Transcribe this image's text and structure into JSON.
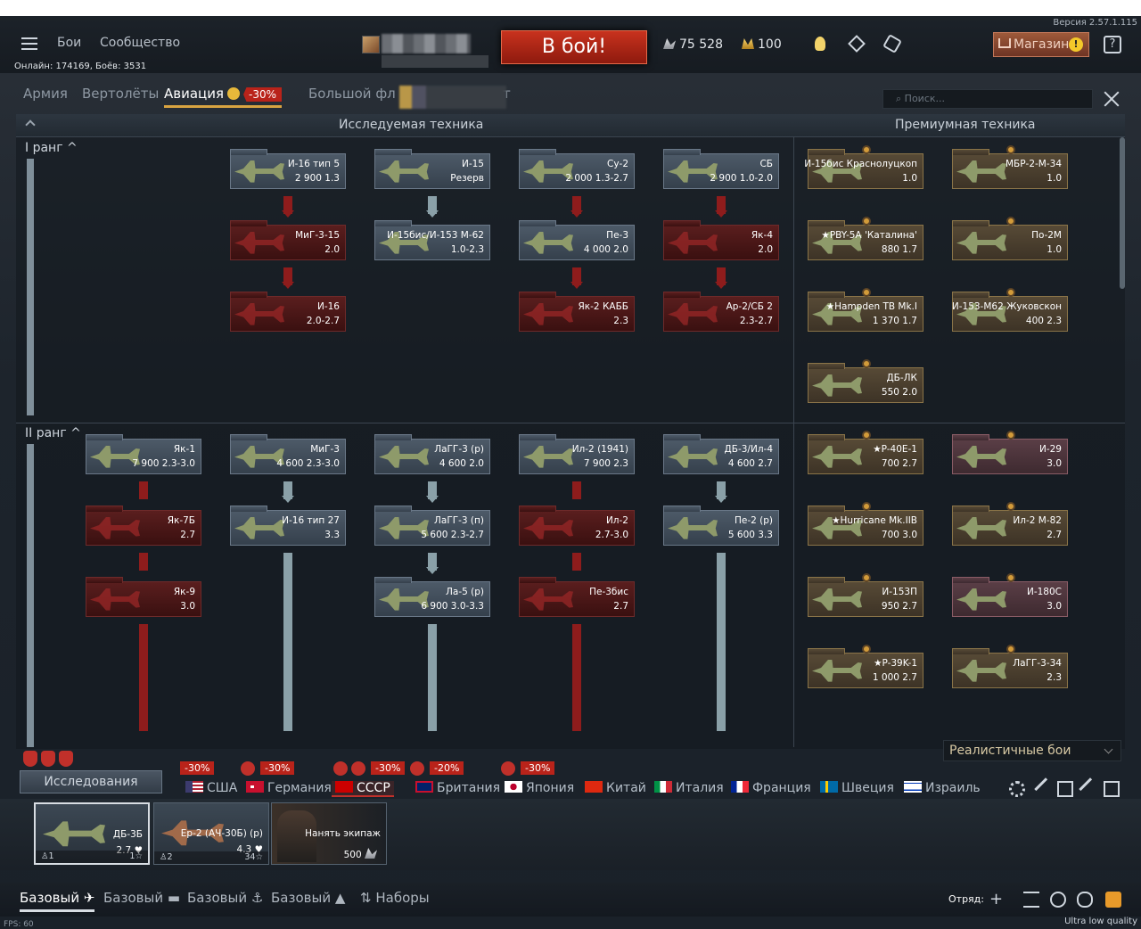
{
  "header": {
    "version": "Версия 2.57.1.115",
    "nav": [
      "Бои",
      "Сообщество"
    ],
    "online": "Онлайн: 174169, Боёв: 3531",
    "battle_button": "В бой!",
    "silver": "75 528",
    "gold": "100",
    "shop": "Магазин",
    "shop_alert": "!",
    "help": "?"
  },
  "tabs": {
    "items": [
      "Армия",
      "Вертолёты",
      "Авиация",
      "Большой фл"
    ],
    "active_discount": "-30%",
    "fleet_suffix": "т"
  },
  "search": {
    "placeholder": "Поиск..."
  },
  "tree": {
    "researched_title": "Исследуемая техника",
    "premium_title": "Премиумная техника",
    "rank1": "I ранг",
    "rank2": "II ранг",
    "cards": [
      {
        "id": "c1",
        "name": "И-16 тип 5",
        "stats": "2 900 1.3",
        "state": "normal"
      },
      {
        "id": "c2",
        "name": "И-15",
        "stats": "Резерв",
        "state": "normal"
      },
      {
        "id": "c3",
        "name": "Су-2",
        "stats": "2 000 1.3-2.7",
        "state": "normal"
      },
      {
        "id": "c4",
        "name": "СБ",
        "stats": "2 900 1.0-2.0",
        "state": "normal"
      },
      {
        "id": "c5",
        "name": "МиГ-3-15",
        "stats": "2.0",
        "state": "locked"
      },
      {
        "id": "c6",
        "name": "И-15бис/И-153 М-62",
        "stats": "1.0-2.3",
        "state": "normal"
      },
      {
        "id": "c7",
        "name": "Пе-3",
        "stats": "4 000 2.0",
        "state": "normal"
      },
      {
        "id": "c8",
        "name": "Як-4",
        "stats": "2.0",
        "state": "locked"
      },
      {
        "id": "c9",
        "name": "И-16",
        "stats": "2.0-2.7",
        "state": "locked"
      },
      {
        "id": "c10",
        "name": "Як-2 КАББ",
        "stats": "2.3",
        "state": "locked"
      },
      {
        "id": "c11",
        "name": "Ар-2/СБ 2",
        "stats": "2.3-2.7",
        "state": "locked"
      },
      {
        "id": "c12",
        "name": "Як-1",
        "stats": "7 900 2.3-3.0",
        "state": "normal"
      },
      {
        "id": "c13",
        "name": "МиГ-3",
        "stats": "4 600 2.3-3.0",
        "state": "normal"
      },
      {
        "id": "c14",
        "name": "ЛаГГ-3 (р)",
        "stats": "4 600 2.0",
        "state": "normal"
      },
      {
        "id": "c15",
        "name": "Ил-2 (1941)",
        "stats": "7 900 2.3",
        "state": "normal"
      },
      {
        "id": "c16",
        "name": "ДБ-3/Ил-4",
        "stats": "4 600 2.7",
        "state": "normal"
      },
      {
        "id": "c17",
        "name": "Як-7Б",
        "stats": "2.7",
        "state": "locked"
      },
      {
        "id": "c18",
        "name": "И-16 тип 27",
        "stats": "3.3",
        "state": "normal"
      },
      {
        "id": "c19",
        "name": "ЛаГГ-3 (п)",
        "stats": "5 600 2.3-2.7",
        "state": "normal"
      },
      {
        "id": "c20",
        "name": "Ил-2",
        "stats": "2.7-3.0",
        "state": "locked"
      },
      {
        "id": "c21",
        "name": "Пе-2 (р)",
        "stats": "5 600 3.3",
        "state": "normal"
      },
      {
        "id": "c22",
        "name": "Як-9",
        "stats": "3.0",
        "state": "locked"
      },
      {
        "id": "c23",
        "name": "Ла-5 (р)",
        "stats": "6 900 3.0-3.3",
        "state": "normal"
      },
      {
        "id": "c24",
        "name": "Пе-3бис",
        "stats": "2.7",
        "state": "locked"
      }
    ],
    "premium": [
      {
        "id": "p1",
        "name": "И-15бис Краснолуцкоп",
        "stats": "1.0",
        "state": "prem"
      },
      {
        "id": "p2",
        "name": "МБР-2-М-34",
        "stats": "1.0",
        "state": "prem"
      },
      {
        "id": "p3",
        "name": "★PBY-5A 'Каталина'",
        "stats": "880 1.7",
        "state": "prem"
      },
      {
        "id": "p4",
        "name": "По-2М",
        "stats": "1.0",
        "state": "prem"
      },
      {
        "id": "p5",
        "name": "★Hampden TB Mk.I",
        "stats": "1 370 1.7",
        "state": "prem"
      },
      {
        "id": "p6",
        "name": "И-153-М62 Жуковскон",
        "stats": "400 2.3",
        "state": "prem"
      },
      {
        "id": "p7",
        "name": "ДБ-ЛК",
        "stats": "550 2.0",
        "state": "prem"
      },
      {
        "id": "p8",
        "name": "★P-40E-1",
        "stats": "700 2.7",
        "state": "prem"
      },
      {
        "id": "p9",
        "name": "И-29",
        "stats": "3.0",
        "state": "pink"
      },
      {
        "id": "p10",
        "name": "★Hurricane Mk.IIB",
        "stats": "700 3.0",
        "state": "prem"
      },
      {
        "id": "p11",
        "name": "Ил-2 М-82",
        "stats": "2.7",
        "state": "prem"
      },
      {
        "id": "p12",
        "name": "И-153П",
        "stats": "950 2.7",
        "state": "prem"
      },
      {
        "id": "p13",
        "name": "И-180С",
        "stats": "3.0",
        "state": "pink"
      },
      {
        "id": "p14",
        "name": "★P-39K-1",
        "stats": "1 000 2.7",
        "state": "prem"
      },
      {
        "id": "p15",
        "name": "ЛаГГ-3-34",
        "stats": "2.3",
        "state": "prem"
      }
    ]
  },
  "game_mode": "Реалистичные бои",
  "research_button": "Исследования",
  "nations": [
    {
      "name": "США",
      "discount": "-30%"
    },
    {
      "name": "Германия",
      "discount": "-30%"
    },
    {
      "name": "СССР",
      "discount": "-30%"
    },
    {
      "name": "Британия",
      "discount": "-20%"
    },
    {
      "name": "Япония",
      "discount": "-30%"
    },
    {
      "name": "Китай"
    },
    {
      "name": "Италия"
    },
    {
      "name": "Франция"
    },
    {
      "name": "Швеция"
    },
    {
      "name": "Израиль"
    }
  ],
  "crew": {
    "slots": [
      {
        "name": "ДБ-3Б",
        "br": "2.7",
        "crew": "1",
        "level": "1",
        "top": "–"
      },
      {
        "name": "Ер-2 (АЧ-30Б) (р)",
        "br": "4.3",
        "crew": "2",
        "level": "34",
        "top": "1"
      }
    ],
    "hire_label": "Нанять экипаж",
    "hire_cost": "500"
  },
  "bottom": {
    "tabs": [
      "Базовый",
      "Базовый",
      "Базовый",
      "Базовый",
      "Наборы"
    ],
    "squad": "Отряд:",
    "fps": "FPS: 60",
    "quality": "Ultra low quality"
  }
}
